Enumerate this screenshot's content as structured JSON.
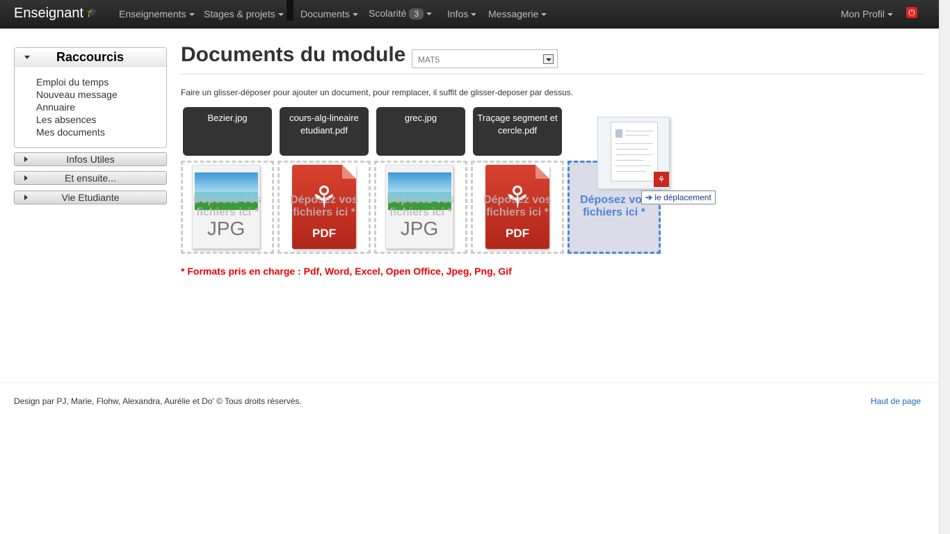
{
  "navbar": {
    "brand": "Enseignant",
    "items": [
      {
        "label": "Enseignements"
      },
      {
        "label": "Stages & projets"
      },
      {
        "label": "Documents"
      },
      {
        "label": "Scolarité",
        "badge": "3"
      },
      {
        "label": "Infos"
      },
      {
        "label": "Messagerie"
      }
    ],
    "profile": "Mon Profil",
    "power_icon": "power-icon",
    "power_color": "#d22222"
  },
  "sidebar": {
    "shortcuts_title": "Raccourcis",
    "links": [
      "Emploi du temps",
      "Nouveau message",
      "Annuaire",
      "Les absences",
      "Mes documents"
    ],
    "accordions": [
      "Infos Utiles",
      "Et ensuite...",
      "Vie Etudiante"
    ]
  },
  "main": {
    "title": "Documents du module",
    "module_select": "MAT5",
    "instructions": "Faire un glisser-déposer pour ajouter un document, pour remplacer, il suffit de glisser-deposer par dessus.",
    "files": [
      {
        "name": "Bezier.jpg",
        "type": "JPG"
      },
      {
        "name": "cours-alg-lineaire etudiant.pdf",
        "type": "PDF"
      },
      {
        "name": "grec.jpg",
        "type": "JPG"
      },
      {
        "name": "Traçage segment et cercle.pdf",
        "type": "PDF"
      }
    ],
    "dropzone_text": "Déposez vos fichiers ici *",
    "drag_tooltip": "le déplacement",
    "formats_note": "* Formats pris en charge : Pdf, Word, Excel, Open Office, Jpeg, Png, Gif",
    "accent_color": "#4a86d8",
    "formats_color": "#ee0000"
  },
  "footer": {
    "credits": "Design par PJ, Marie, Flohw, Alexandra, Aurélie et Do' © Tous droits réservés.",
    "top_link": "Haut de page"
  }
}
